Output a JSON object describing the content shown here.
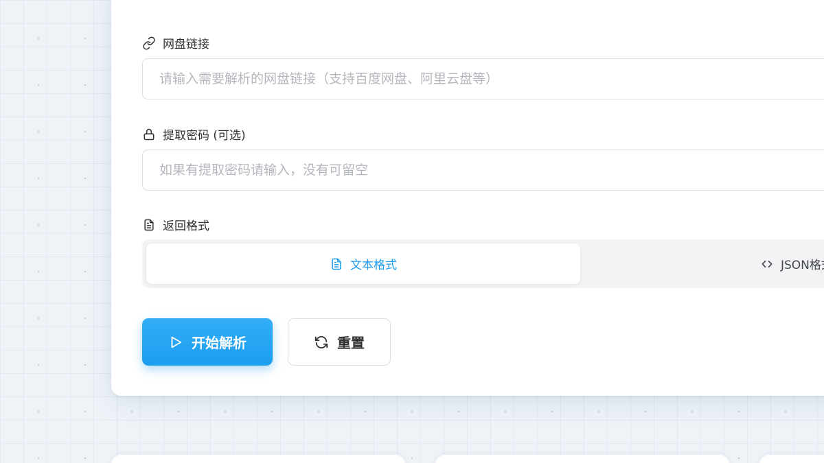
{
  "form": {
    "link": {
      "label": "网盘链接",
      "placeholder": "请输入需要解析的网盘链接（支持百度网盘、阿里云盘等）",
      "icon": "link-icon"
    },
    "password": {
      "label": "提取密码 (可选)",
      "placeholder": "如果有提取密码请输入，没有可留空",
      "icon": "lock-icon"
    },
    "format": {
      "label": "返回格式",
      "icon": "document-icon",
      "options": [
        {
          "label": "文本格式",
          "icon": "document-icon",
          "selected": true
        },
        {
          "label": "JSON格式",
          "icon": "code-icon",
          "selected": false
        }
      ]
    },
    "actions": {
      "start_label": "开始解析",
      "start_icon": "play-icon",
      "reset_label": "重置",
      "reset_icon": "refresh-icon"
    }
  },
  "colors": {
    "accent": "#1f9bef",
    "background": "#eef3f8",
    "card": "#ffffff",
    "text": "#303133",
    "placeholder": "#b4b7bd",
    "border": "#dcdfe6"
  }
}
